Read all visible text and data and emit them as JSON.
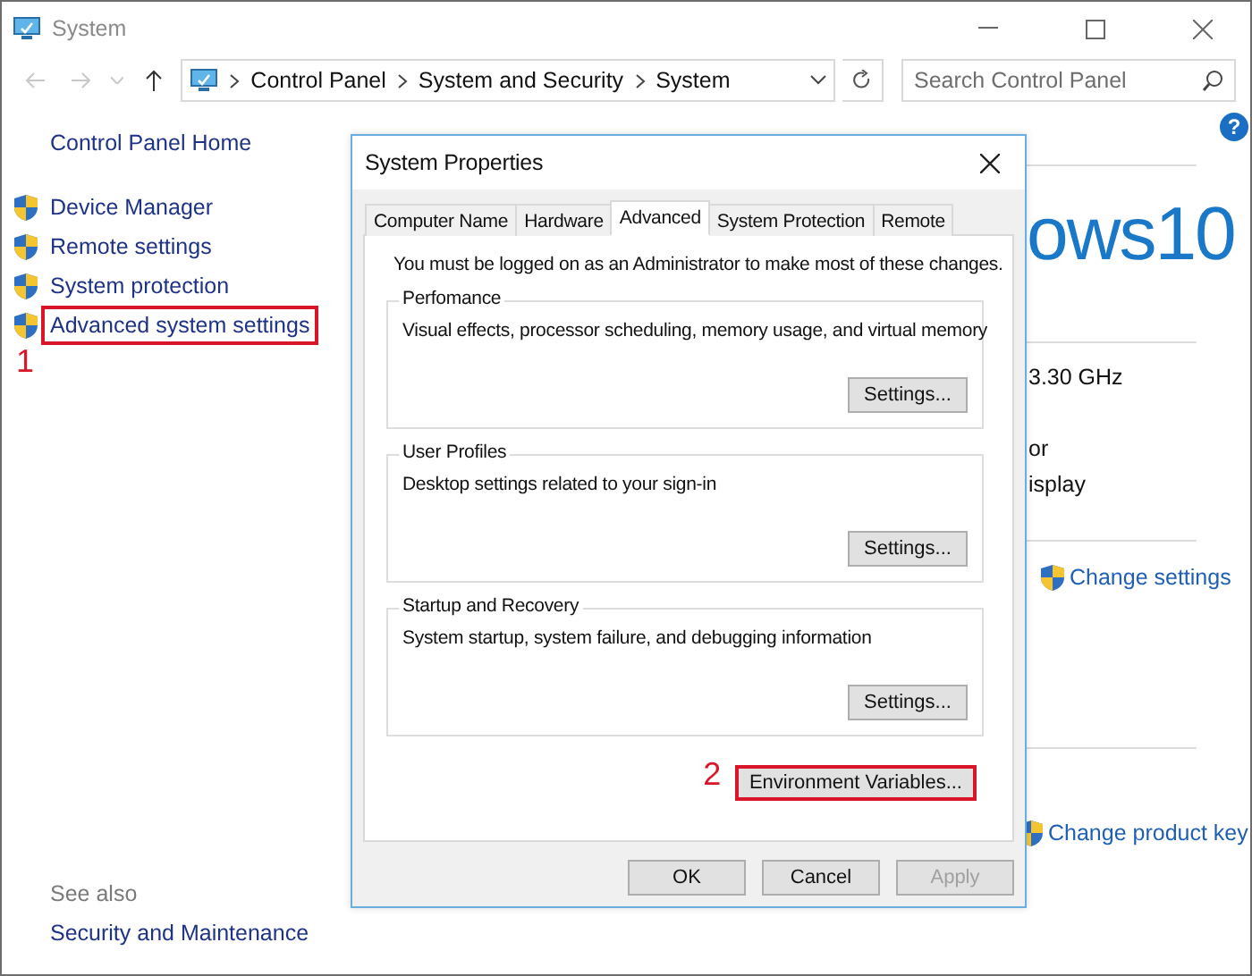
{
  "window": {
    "title": "System"
  },
  "breadcrumb": [
    "Control Panel",
    "System and Security",
    "System"
  ],
  "search": {
    "placeholder": "Search Control Panel"
  },
  "help": "?",
  "sidebar": {
    "home": "Control Panel Home",
    "items": [
      {
        "label": "Device Manager",
        "highlighted": false
      },
      {
        "label": "Remote settings",
        "highlighted": false
      },
      {
        "label": "System protection",
        "highlighted": false
      },
      {
        "label": "Advanced system settings",
        "highlighted": true,
        "callout": "1"
      }
    ],
    "see_also": {
      "heading": "See also",
      "links": [
        "Security and Maintenance"
      ]
    }
  },
  "main": {
    "logo_text": "ows10",
    "processor": "3.30 GHz",
    "line_2": "or",
    "line_3": "isplay",
    "links": [
      "Change settings",
      "Change product key"
    ]
  },
  "dialog": {
    "title": "System Properties",
    "tabs": [
      {
        "label": "Computer Name",
        "selected": false
      },
      {
        "label": "Hardware",
        "selected": false
      },
      {
        "label": "Advanced",
        "selected": true
      },
      {
        "label": "System Protection",
        "selected": false
      },
      {
        "label": "Remote",
        "selected": false
      }
    ],
    "notice": "You must be logged on as an Administrator to make most of these changes.",
    "groups": [
      {
        "title": "Perfomance",
        "description": "Visual effects, processor scheduling, memory usage, and virtual memory",
        "button": "Settings..."
      },
      {
        "title": "User Profiles",
        "description": "Desktop settings related to your sign-in",
        "button": "Settings..."
      },
      {
        "title": "Startup and Recovery",
        "description": "System startup, system failure, and debugging information",
        "button": "Settings..."
      }
    ],
    "environment_button": {
      "label": "Environment Variables...",
      "highlighted": true,
      "callout": "2"
    },
    "buttons": [
      {
        "label": "OK",
        "disabled": false
      },
      {
        "label": "Cancel",
        "disabled": false
      },
      {
        "label": "Apply",
        "disabled": true
      }
    ]
  }
}
